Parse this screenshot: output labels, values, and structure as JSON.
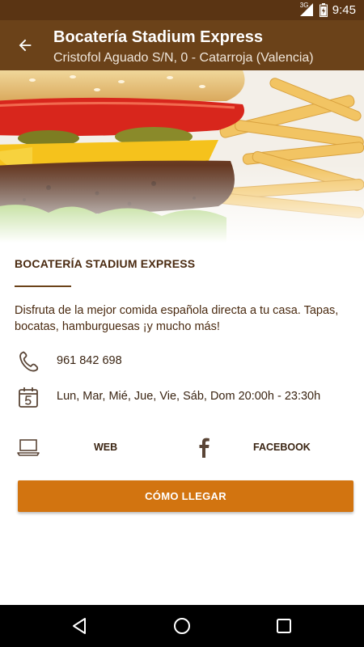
{
  "status_bar": {
    "time": "9:45",
    "network": "3G",
    "icons": [
      "signal-icon",
      "battery-icon"
    ]
  },
  "toolbar": {
    "back_icon": "arrow-back-icon",
    "title": "Bocatería Stadium Express",
    "subtitle": "Cristofol Aguado S/N, 0 - Catarroja (Valencia)"
  },
  "hero": {
    "image": "burger-and-fries-photo"
  },
  "business": {
    "name": "BOCATERÍA STADIUM EXPRESS",
    "description": "Disfruta de la mejor comida española directa a tu casa. Tapas, bocatas, hamburguesas ¡y mucho más!",
    "phone": "961 842 698",
    "hours": "Lun, Mar, Mié, Jue, Vie, Sáb, Dom 20:00h - 23:30h"
  },
  "links": {
    "web_label": "WEB",
    "facebook_label": "FACEBOOK"
  },
  "cta": {
    "label": "CÓMO LLEGAR"
  },
  "nav": {
    "icons": [
      "back-triangle-icon",
      "home-circle-icon",
      "recents-square-icon"
    ]
  },
  "colors": {
    "toolbar": "#6b4219",
    "status_bar": "#5a3413",
    "accent": "#d27410",
    "text": "#4a2a10"
  }
}
